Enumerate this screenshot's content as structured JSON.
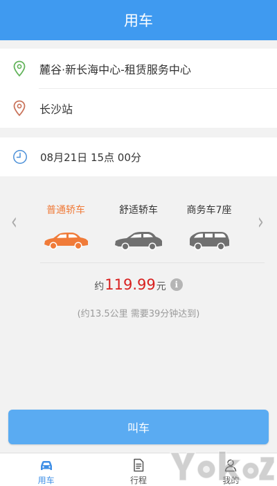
{
  "header": {
    "title": "用车"
  },
  "route": {
    "start": "麓谷·新长海中心-租赁服务中心",
    "end": "长沙站"
  },
  "time": {
    "text": "08月21日 15点 00分"
  },
  "car_types": [
    {
      "label": "普通轿车",
      "selected": true
    },
    {
      "label": "舒适轿车",
      "selected": false
    },
    {
      "label": "商务车7座",
      "selected": false
    }
  ],
  "price": {
    "prefix": "约",
    "amount": "119.99",
    "unit": "元"
  },
  "estimate": "(约13.5公里 需要39分钟达到)",
  "call_button": "叫车",
  "tabs": [
    {
      "label": "用车",
      "icon": "car-icon",
      "active": true
    },
    {
      "label": "行程",
      "icon": "document-icon",
      "active": false
    },
    {
      "label": "我的",
      "icon": "person-icon",
      "active": false
    }
  ],
  "colors": {
    "header": "#3f9af0",
    "selected_car": "#f07b39",
    "price": "#d8201f",
    "button": "#5aabf2",
    "start_pin": "#62b35a",
    "end_pin": "#c9735a",
    "active_tab": "#3f8fe6"
  },
  "watermark": "Yokoz"
}
